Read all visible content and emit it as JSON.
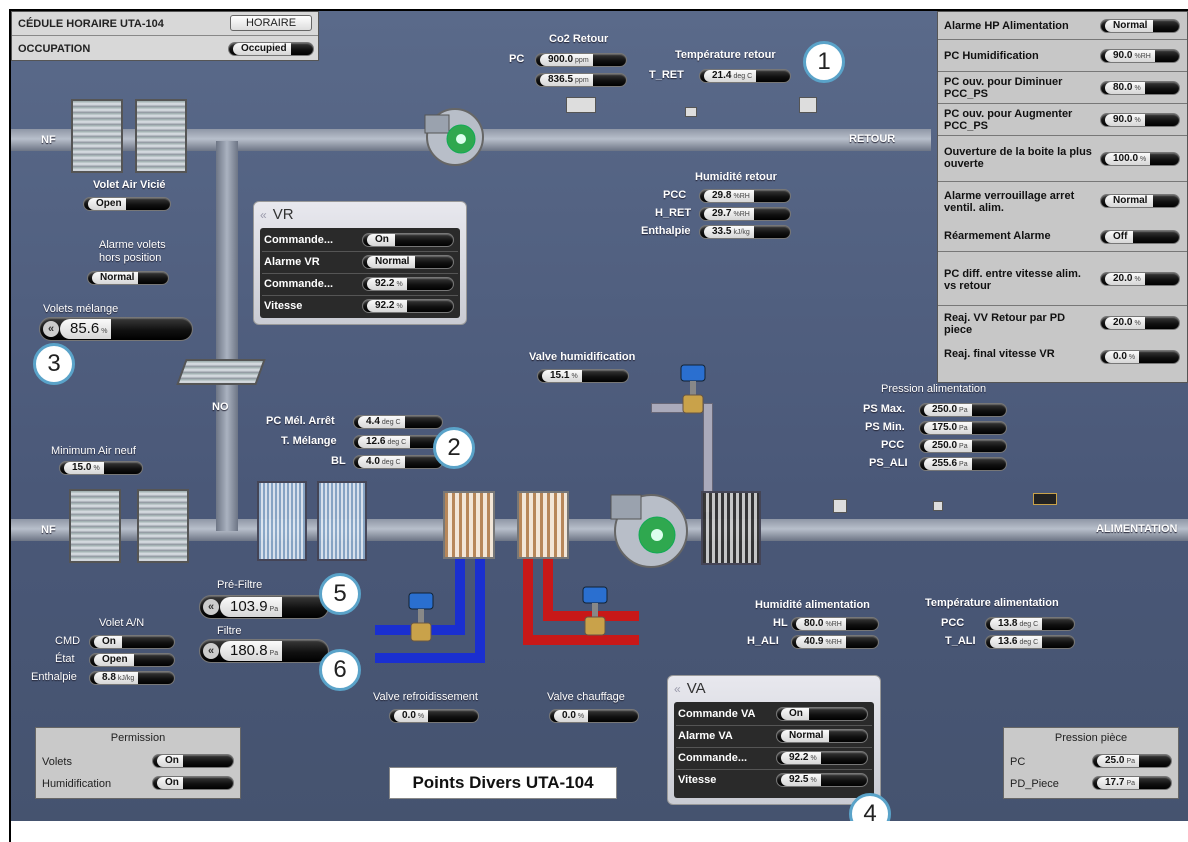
{
  "top_left": {
    "schedule_label": "CÉDULE HORAIRE UTA-104",
    "schedule_button": "HORAIRE",
    "occupation_label": "OCCUPATION",
    "occupation_value": "Occupied"
  },
  "duct_labels": {
    "nf_top": "NF",
    "retour": "RETOUR",
    "nf_bottom": "NF",
    "alimentation": "ALIMENTATION",
    "no": "NO"
  },
  "co2": {
    "title": "Co2 Retour",
    "pc_label": "PC",
    "pc_value": "900.0",
    "pc_unit": "ppm",
    "value": "836.5",
    "unit": "ppm"
  },
  "temp_retour": {
    "title": "Température retour",
    "label": "T_RET",
    "value": "21.4",
    "unit": "deg C"
  },
  "humid_retour": {
    "title": "Humidité retour",
    "rows": [
      {
        "label": "PCC",
        "value": "29.8",
        "unit": "%RH"
      },
      {
        "label": "H_RET",
        "value": "29.7",
        "unit": "%RH"
      },
      {
        "label": "Enthalpie",
        "value": "33.5",
        "unit": "kJ/kg"
      }
    ]
  },
  "volet_vicie": {
    "title": "Volet Air Vicié",
    "value": "Open"
  },
  "alarme_volets": {
    "title_1": "Alarme volets",
    "title_2": "hors position",
    "value": "Normal"
  },
  "volets_melange": {
    "title": "Volets mélange",
    "value": "85.6",
    "unit": "%"
  },
  "vr": {
    "title": "VR",
    "rows": [
      {
        "label": "Commande...",
        "value": "On",
        "unit": ""
      },
      {
        "label": "Alarme VR",
        "value": "Normal",
        "unit": ""
      },
      {
        "label": "Commande...",
        "value": "92.2",
        "unit": "%"
      },
      {
        "label": "Vitesse",
        "value": "92.2",
        "unit": "%"
      }
    ]
  },
  "valve_humid": {
    "title": "Valve humidification",
    "value": "15.1",
    "unit": "%"
  },
  "melange": {
    "rows": [
      {
        "label": "PC Mél. Arrêt",
        "value": "4.4",
        "unit": "deg C"
      },
      {
        "label": "T. Mélange",
        "value": "12.6",
        "unit": "deg C"
      },
      {
        "label": "BL",
        "value": "4.0",
        "unit": "deg C"
      }
    ]
  },
  "min_air": {
    "title": "Minimum Air neuf",
    "value": "15.0",
    "unit": "%"
  },
  "volet_an": {
    "title": "Volet A/N",
    "rows": [
      {
        "label": "CMD",
        "value": "On",
        "unit": ""
      },
      {
        "label": "État",
        "value": "Open",
        "unit": ""
      },
      {
        "label": "Enthalpie",
        "value": "8.8",
        "unit": "kJ/kg"
      }
    ]
  },
  "prefiltre": {
    "title": "Pré-Filtre",
    "value": "103.9",
    "unit": "Pa"
  },
  "filtre": {
    "title": "Filtre",
    "value": "180.8",
    "unit": "Pa"
  },
  "valve_refroid": {
    "title": "Valve refroidissement",
    "value": "0.0",
    "unit": "%"
  },
  "valve_chauff": {
    "title": "Valve chauffage",
    "value": "0.0",
    "unit": "%"
  },
  "pression_alim": {
    "title": "Pression alimentation",
    "rows": [
      {
        "label": "PS Max.",
        "value": "250.0",
        "unit": "Pa"
      },
      {
        "label": "PS Min.",
        "value": "175.0",
        "unit": "Pa"
      },
      {
        "label": "PCC",
        "value": "250.0",
        "unit": "Pa"
      },
      {
        "label": "PS_ALI",
        "value": "255.6",
        "unit": "Pa"
      }
    ]
  },
  "humid_alim": {
    "title": "Humidité alimentation",
    "rows": [
      {
        "label": "HL",
        "value": "80.0",
        "unit": "%RH"
      },
      {
        "label": "H_ALI",
        "value": "40.9",
        "unit": "%RH"
      }
    ]
  },
  "temp_alim": {
    "title": "Température alimentation",
    "rows": [
      {
        "label": "PCC",
        "value": "13.8",
        "unit": "deg C"
      },
      {
        "label": "T_ALI",
        "value": "13.6",
        "unit": "deg C"
      }
    ]
  },
  "va": {
    "title": "VA",
    "rows": [
      {
        "label": "Commande VA",
        "value": "On",
        "unit": ""
      },
      {
        "label": "Alarme VA",
        "value": "Normal",
        "unit": ""
      },
      {
        "label": "Commande...",
        "value": "92.2",
        "unit": "%"
      },
      {
        "label": "Vitesse",
        "value": "92.5",
        "unit": "%"
      }
    ]
  },
  "permission": {
    "title": "Permission",
    "rows": [
      {
        "label": "Volets",
        "value": "On"
      },
      {
        "label": "Humidification",
        "value": "On"
      }
    ]
  },
  "points_divers": "Points Divers UTA-104",
  "pression_piece": {
    "title": "Pression pièce",
    "rows": [
      {
        "label": "PC",
        "value": "25.0",
        "unit": "Pa"
      },
      {
        "label": "PD_Piece",
        "value": "17.7",
        "unit": "Pa"
      }
    ]
  },
  "right_panel": [
    {
      "label": "Alarme HP Alimentation",
      "value": "Normal",
      "unit": ""
    },
    {
      "label": "PC Humidification",
      "value": "90.0",
      "unit": "%RH"
    },
    {
      "label": "PC ouv. pour Diminuer PCC_PS",
      "value": "80.0",
      "unit": "%"
    },
    {
      "label": "PC ouv. pour Augmenter PCC_PS",
      "value": "90.0",
      "unit": "%"
    },
    {
      "label": "Ouverture de la boite la plus ouverte",
      "value": "100.0",
      "unit": "%"
    },
    {
      "label": "Alarme verrouillage arret ventil. alim.",
      "value": "Normal",
      "unit": ""
    },
    {
      "label": "Réarmement Alarme",
      "value": "Off",
      "unit": ""
    },
    {
      "label": "PC diff. entre vitesse alim. vs retour",
      "value": "20.0",
      "unit": "%"
    },
    {
      "label": "Reaj. VV Retour par PD piece",
      "value": "20.0",
      "unit": "%"
    },
    {
      "label": "Reaj. final vitesse VR",
      "value": "0.0",
      "unit": "%"
    }
  ],
  "callouts": [
    "1",
    "2",
    "3",
    "4",
    "5",
    "6"
  ],
  "colors": {
    "background": "#4f5e7e",
    "chilled_water": "#1a2fd0",
    "hot_water": "#c81818",
    "callout_ring": "#5aa3c9"
  },
  "icons": [
    "fan-icon",
    "damper-icon",
    "filter-icon",
    "coil-icon",
    "valve-icon",
    "sensor-icon"
  ]
}
